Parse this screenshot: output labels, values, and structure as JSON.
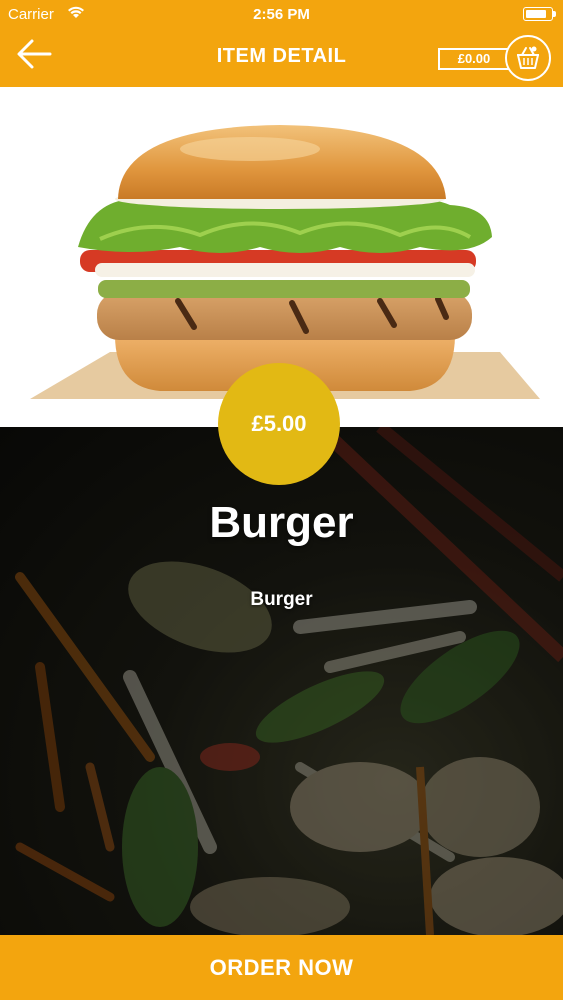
{
  "status_bar": {
    "carrier": "Carrier",
    "time": "2:56 PM"
  },
  "nav": {
    "title": "ITEM DETAIL",
    "cart_total": "£0.00",
    "back_icon": "arrow-left-icon",
    "cart_icon": "basket-icon"
  },
  "item": {
    "price": "£5.00",
    "name": "Burger",
    "description": "Burger"
  },
  "actions": {
    "order_label": "ORDER NOW"
  },
  "colors": {
    "brand": "#f3a50e",
    "price_badge": "#e2b914",
    "text": "#ffffff"
  }
}
